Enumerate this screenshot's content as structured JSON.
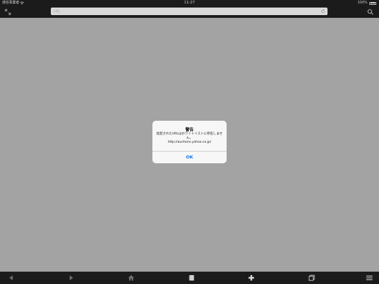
{
  "status_bar": {
    "carrier": "通信事業者",
    "time": "11:27",
    "battery": "100%"
  },
  "nav": {
    "url_placeholder": "URL"
  },
  "alert": {
    "title": "警告",
    "message": "指定されたURLはホワイトリストに存在しません。\nhttp://auctions.yahoo.co.jp/",
    "ok_label": "OK"
  },
  "toolbar": {
    "items": [
      "back-icon",
      "forward-icon",
      "home-icon",
      "bookmarks-icon",
      "add-icon",
      "tabs-icon",
      "menu-icon"
    ]
  },
  "colors": {
    "bar_background": "#1b1b1b",
    "content_background": "#a3a3a3",
    "alert_background": "#f7f7f7",
    "accent": "#1a7be0"
  }
}
